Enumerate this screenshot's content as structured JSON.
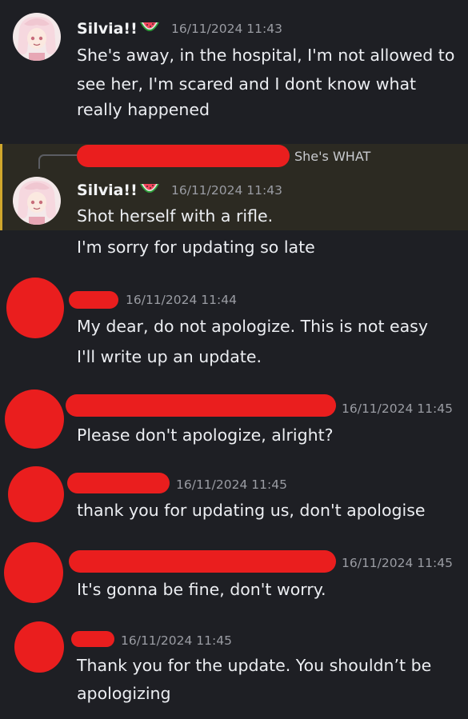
{
  "messages": [
    {
      "author": "Silvia!!",
      "timestamp": "16/11/2024 11:43",
      "lines": [
        "She's away, in the hospital, I'm not allowed to",
        "see her, I'm scared and I dont know what",
        "really happened"
      ]
    },
    {
      "reply_preview": "She's WHAT",
      "author": "Silvia!!",
      "timestamp": "16/11/2024 11:43",
      "lines": [
        "Shot herself with a rifle.",
        "I'm sorry for updating so late"
      ]
    },
    {
      "timestamp": "16/11/2024 11:44",
      "lines": [
        "My dear, do not apologize. This is not easy",
        "I'll write up an update."
      ]
    },
    {
      "timestamp": "16/11/2024 11:45",
      "lines": [
        "Please don't apologize, alright?"
      ]
    },
    {
      "timestamp": "16/11/2024 11:45",
      "lines": [
        "thank you for updating us, don't apologise"
      ]
    },
    {
      "timestamp": "16/11/2024 11:45",
      "lines": [
        "It's gonna be fine, don't worry."
      ]
    },
    {
      "timestamp": "16/11/2024 11:45",
      "lines": [
        "Thank you for the update. You shouldn’t be",
        "apologizing"
      ]
    }
  ],
  "icons": {
    "author_badge": "watermelon-icon",
    "avatar": "anime-character-avatar"
  },
  "colors": {
    "background": "#1e1f24",
    "highlight_background": "#2c2a22",
    "highlight_accent": "#d0a72c",
    "redaction": "#ea1e1e",
    "timestamp": "#9a9ca3",
    "text": "#eceef2"
  }
}
